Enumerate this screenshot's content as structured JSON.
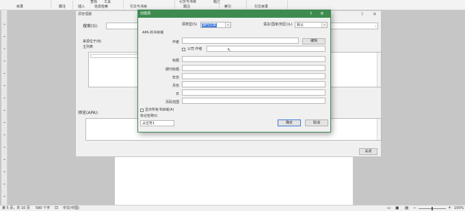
{
  "ribbon": {
    "row1": [
      "查找",
      "工具",
      "引文与书目",
      "题注"
    ],
    "row2": [
      "目录",
      "脚注",
      "插入",
      "信息检索",
      "引文与书目",
      "题注",
      "索引",
      "引文目录"
    ]
  },
  "status_bar": {
    "page": "第 5 页，共 10 页",
    "words": "590 个字",
    "language": "中文(中国)",
    "zoom": "100%"
  },
  "manager": {
    "title": "源管理器",
    "search_label": "搜索(S):",
    "source_label": "来源位于(B)",
    "master_list_label": "主列表",
    "preview_label": "预览(APA):",
    "close_button": "关闭"
  },
  "create_source": {
    "title": "创建源",
    "source_type_label": "源类型(S)",
    "source_type_value": "期刊文章",
    "language_label": "语言(国家/地区)(L)",
    "language_value": "默认",
    "section_label": "APA 的书目域",
    "author_label": "作者",
    "edit_button": "编辑",
    "corporate_author_label": "公司 作者",
    "fields": [
      {
        "label": "标题",
        "value": ""
      },
      {
        "label": "期刊标题",
        "value": ""
      },
      {
        "label": "年份",
        "value": ""
      },
      {
        "label": "月份",
        "value": ""
      },
      {
        "label": "日",
        "value": ""
      },
      {
        "label": "页码范围",
        "value": ""
      }
    ],
    "show_all_label": "显示所有书目域(A)",
    "tag_name_label": "标记名称(I)",
    "tag_name_value": "占位符1",
    "ok_button": "确定",
    "cancel_button": "取消"
  }
}
